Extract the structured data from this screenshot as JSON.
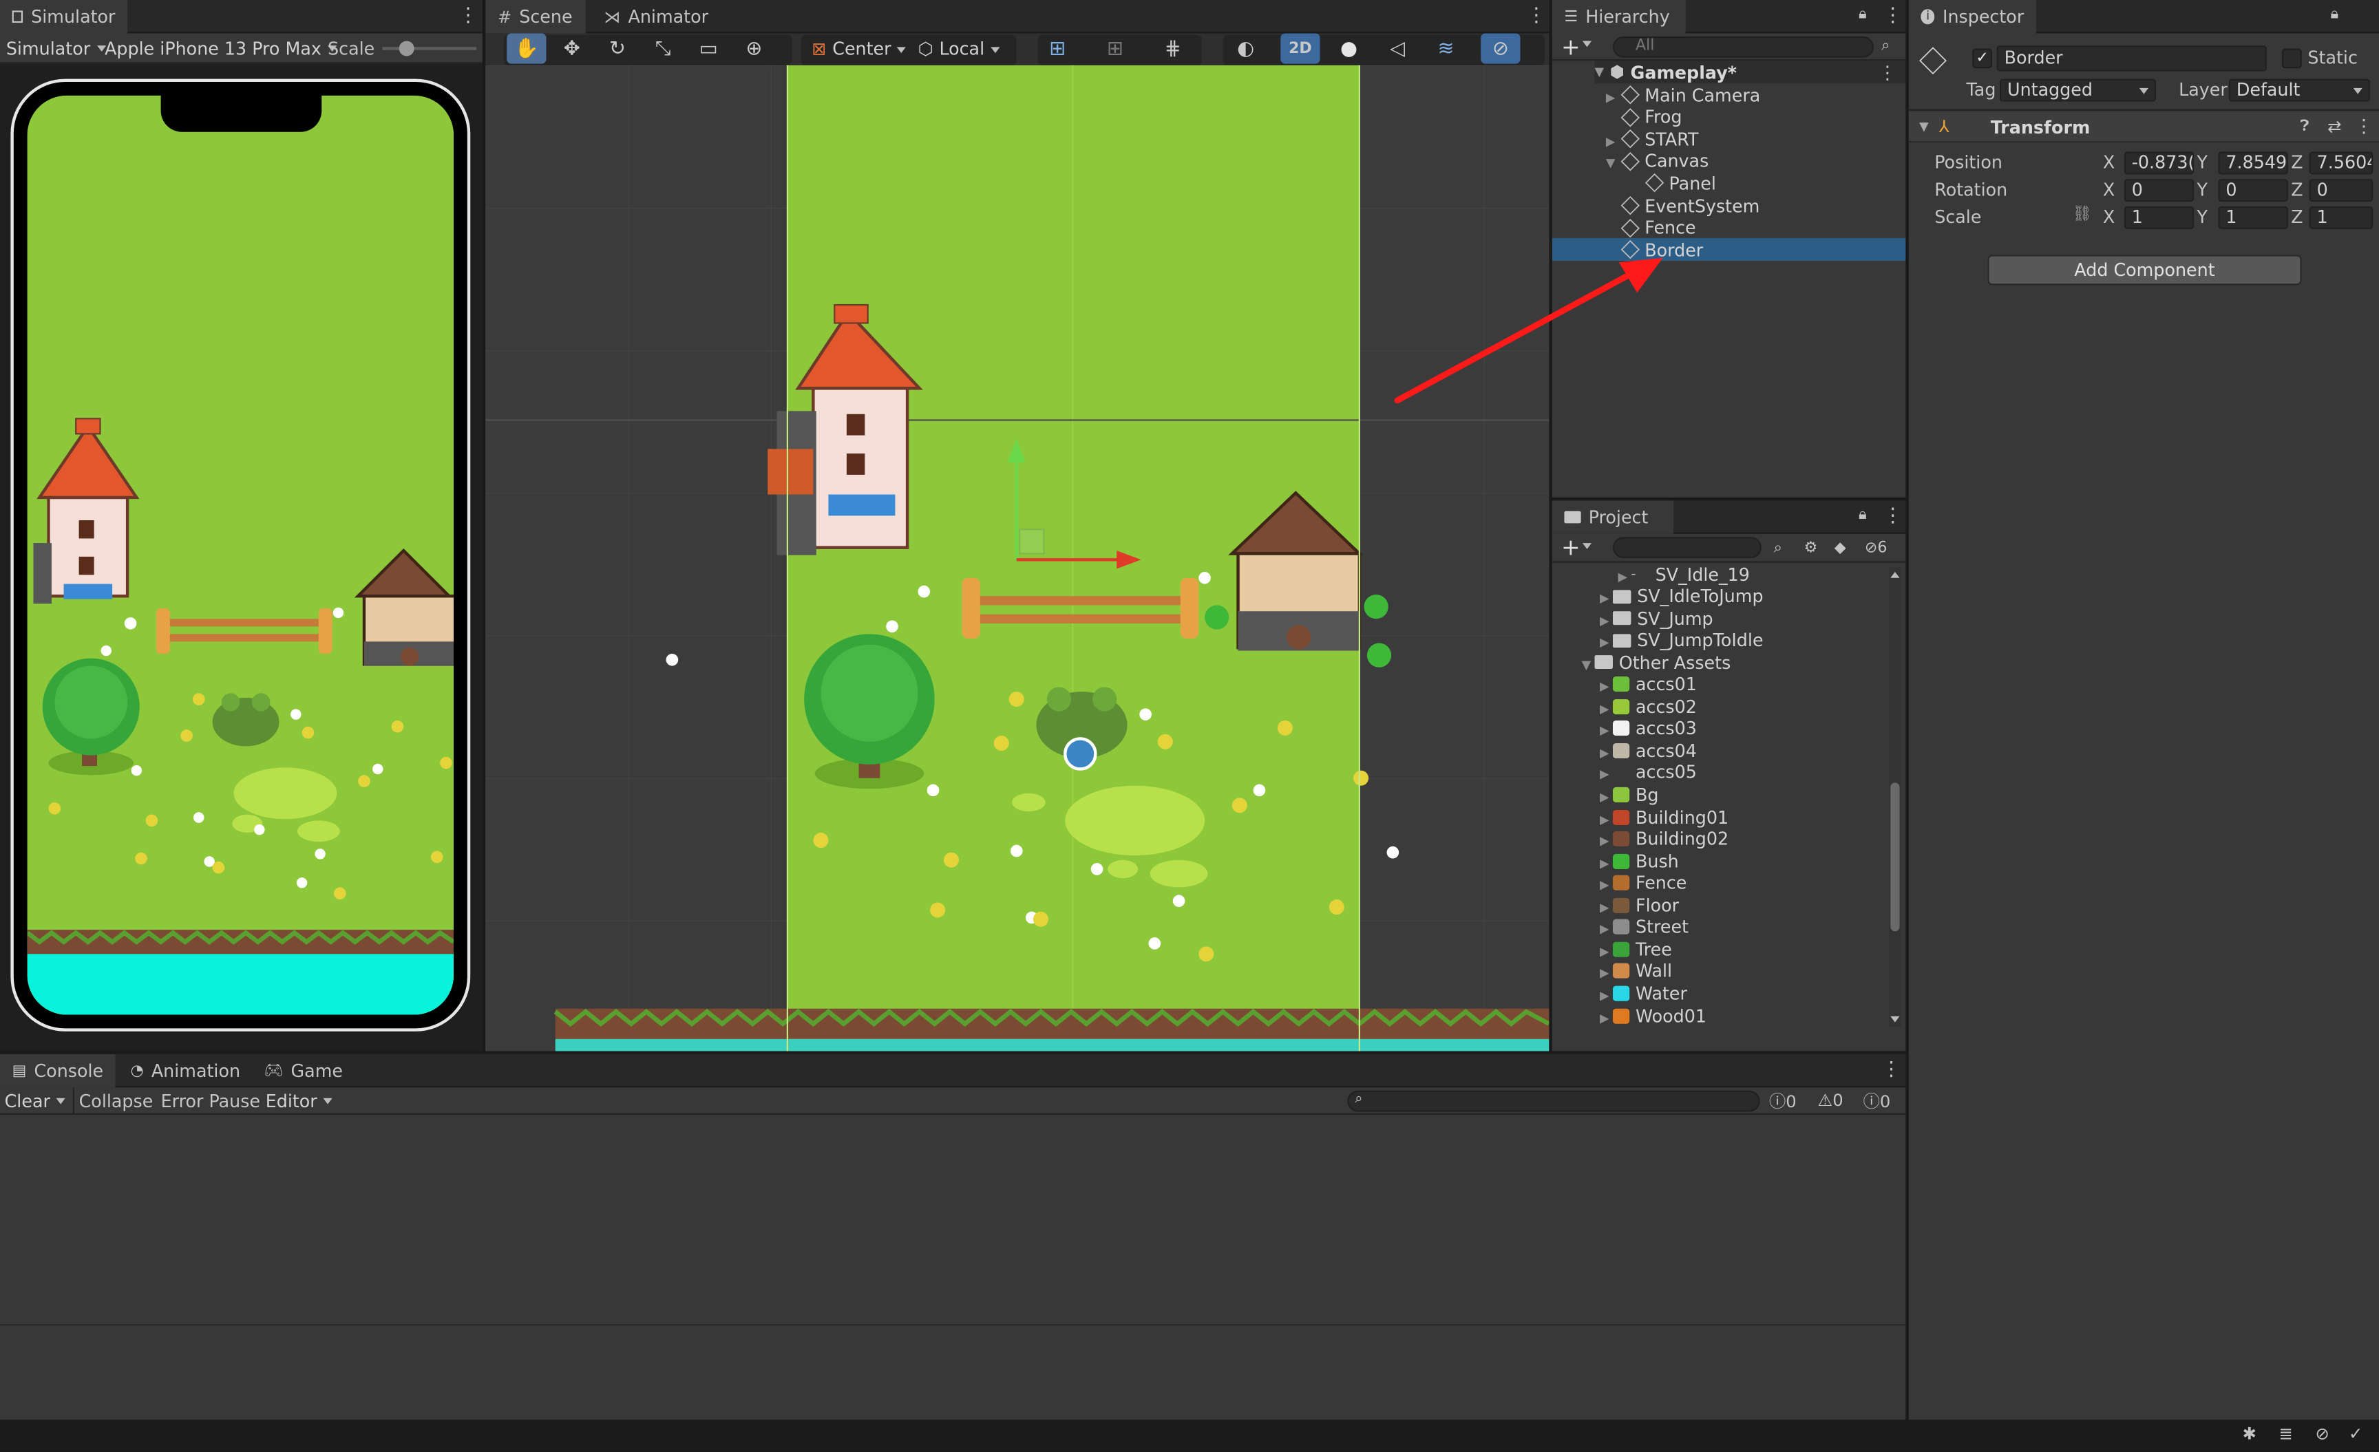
{
  "simulator": {
    "tab": "Simulator",
    "toolbar": {
      "mode": "Simulator",
      "device": "Apple iPhone 13 Pro Max",
      "scale": "Scale"
    },
    "scale_value": 0.2
  },
  "scene": {
    "tabs": [
      "Scene",
      "Animator"
    ],
    "pivot": "Center",
    "space": "Local",
    "mode_2d": "2D"
  },
  "hierarchy": {
    "tab": "Hierarchy",
    "search_placeholder": "All",
    "root": "Gameplay*",
    "items": [
      {
        "name": "Main Camera",
        "expandable": true
      },
      {
        "name": "Frog",
        "expandable": false
      },
      {
        "name": "START",
        "expandable": true
      },
      {
        "name": "Canvas",
        "expandable": true,
        "expanded": true
      },
      {
        "name": "Panel",
        "expandable": false,
        "child": true
      },
      {
        "name": "EventSystem",
        "expandable": false
      },
      {
        "name": "Fence",
        "expandable": false
      },
      {
        "name": "Border",
        "expandable": false,
        "selected": true
      }
    ]
  },
  "project": {
    "tab": "Project",
    "hidden_count": "6",
    "items": [
      {
        "name": "SV_Idle_19",
        "type": "anim",
        "indent": 3
      },
      {
        "name": "SV_IdleToJump",
        "type": "folder",
        "indent": 2
      },
      {
        "name": "SV_Jump",
        "type": "folder",
        "indent": 2
      },
      {
        "name": "SV_JumpToIdle",
        "type": "folder",
        "indent": 2
      },
      {
        "name": "Other Assets",
        "type": "folder",
        "indent": 1,
        "expanded": true
      },
      {
        "name": "accs01",
        "type": "asset",
        "indent": 2,
        "color": "#6bbf3a"
      },
      {
        "name": "accs02",
        "type": "asset",
        "indent": 2,
        "color": "#98c93a"
      },
      {
        "name": "accs03",
        "type": "asset",
        "indent": 2,
        "color": "#f2f2f2"
      },
      {
        "name": "accs04",
        "type": "asset",
        "indent": 2,
        "color": "#bfb8a8"
      },
      {
        "name": "accs05",
        "type": "asset",
        "indent": 2,
        "color": ""
      },
      {
        "name": "Bg",
        "type": "asset",
        "indent": 2,
        "color": "#8cc63e"
      },
      {
        "name": "Building01",
        "type": "asset",
        "indent": 2,
        "color": "#c0462a"
      },
      {
        "name": "Building02",
        "type": "asset",
        "indent": 2,
        "color": "#7b4b33"
      },
      {
        "name": "Bush",
        "type": "asset",
        "indent": 2,
        "color": "#3fb83a"
      },
      {
        "name": "Fence",
        "type": "asset",
        "indent": 2,
        "color": "#b56d2e"
      },
      {
        "name": "Floor",
        "type": "asset",
        "indent": 2,
        "color": "#7a5a3a"
      },
      {
        "name": "Street",
        "type": "asset",
        "indent": 2,
        "color": "#8d8d8d"
      },
      {
        "name": "Tree",
        "type": "asset",
        "indent": 2,
        "color": "#3aa43a"
      },
      {
        "name": "Wall",
        "type": "asset",
        "indent": 2,
        "color": "#d08a4a"
      },
      {
        "name": "Water",
        "type": "asset",
        "indent": 2,
        "color": "#29d7e6"
      },
      {
        "name": "Wood01",
        "type": "asset",
        "indent": 2,
        "color": "#e07a20"
      }
    ]
  },
  "inspector": {
    "tab": "Inspector",
    "object_name": "Border",
    "static_label": "Static",
    "tag_label": "Tag",
    "tag_value": "Untagged",
    "layer_label": "Layer",
    "layer_value": "Default",
    "component": "Transform",
    "position_label": "Position",
    "rotation_label": "Rotation",
    "scale_label": "Scale",
    "position": {
      "x": "-0.873(",
      "y": "7.8549(",
      "z": "7.5604'"
    },
    "rotation": {
      "x": "0",
      "y": "0",
      "z": "0"
    },
    "scale": {
      "x": "1",
      "y": "1",
      "z": "1"
    },
    "add_component": "Add Component"
  },
  "console": {
    "tabs": [
      "Console",
      "Animation",
      "Game"
    ],
    "toolbar": {
      "clear": "Clear",
      "collapse": "Collapse",
      "error_pause": "Error Pause",
      "editor": "Editor"
    },
    "counts": {
      "logs": "0",
      "warnings": "0",
      "errors": "0"
    }
  },
  "colors": {
    "grass": "#8cc83a",
    "selection": "#2c5d87",
    "annotation": "#ff1a1a",
    "water": "#2ee8ec"
  }
}
